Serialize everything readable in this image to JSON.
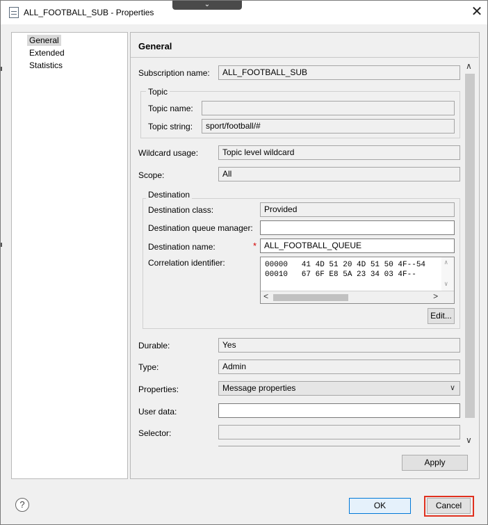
{
  "window": {
    "title": "ALL_FOOTBALL_SUB - Properties",
    "tab_chevron": "⌄",
    "close_glyph": "✕"
  },
  "nav": {
    "items": [
      {
        "label": "General",
        "selected": true
      },
      {
        "label": "Extended",
        "selected": false
      },
      {
        "label": "Statistics",
        "selected": false
      }
    ]
  },
  "general": {
    "section_title": "General",
    "subscription_name_label": "Subscription name:",
    "subscription_name_value": "ALL_FOOTBALL_SUB",
    "topic_group_label": "Topic",
    "topic_name_label": "Topic name:",
    "topic_name_value": "",
    "topic_string_label": "Topic string:",
    "topic_string_value": "sport/football/#",
    "wildcard_label": "Wildcard usage:",
    "wildcard_value": "Topic level wildcard",
    "scope_label": "Scope:",
    "scope_value": "All",
    "destination_group_label": "Destination",
    "dest_class_label": "Destination class:",
    "dest_class_value": "Provided",
    "dest_qmgr_label": "Destination queue manager:",
    "dest_qmgr_value": "",
    "dest_name_label": "Destination name:",
    "dest_name_required": "*",
    "dest_name_value": "ALL_FOOTBALL_QUEUE",
    "correl_label": "Correlation identifier:",
    "correl_lines": [
      "00000   41 4D 51 20 4D 51 50 4F--54",
      "00010   67 6F E8 5A 23 34 03 4F--"
    ],
    "edit_button": "Edit...",
    "durable_label": "Durable:",
    "durable_value": "Yes",
    "type_label": "Type:",
    "type_value": "Admin",
    "properties_label": "Properties:",
    "properties_value": "Message properties",
    "user_data_label": "User data:",
    "user_data_value": "",
    "selector_label": "Selector:",
    "selector_value": "",
    "apply_button": "Apply"
  },
  "footer": {
    "help_glyph": "?",
    "ok_button": "OK",
    "cancel_button": "Cancel"
  },
  "colors": {
    "highlight": "#e0301e",
    "required": "#d40000",
    "primary_border": "#0078d7"
  }
}
